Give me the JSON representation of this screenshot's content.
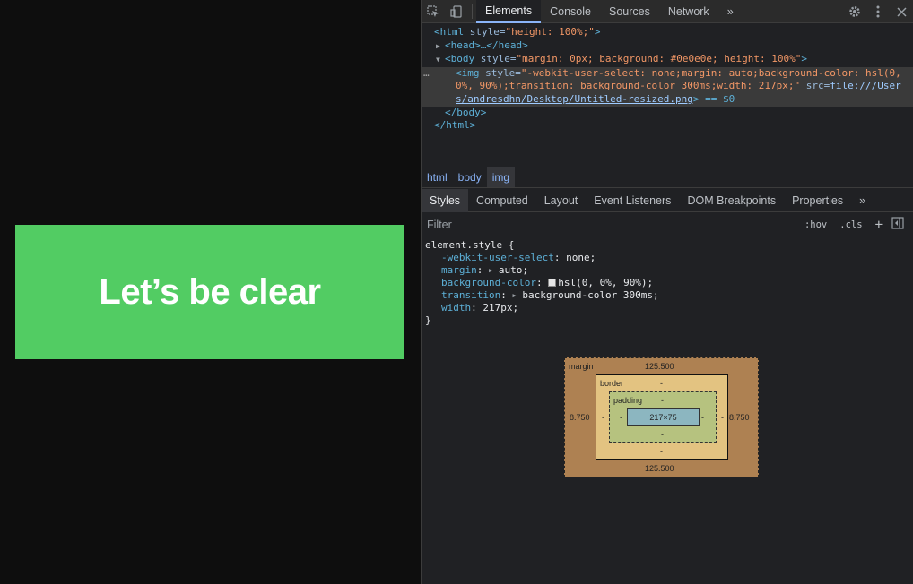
{
  "viewport": {
    "image_text": "Let’s be clear",
    "image_color": "#52cc63"
  },
  "devtools": {
    "tabs": [
      "Elements",
      "Console",
      "Sources",
      "Network"
    ],
    "more_tabs": "»",
    "dom": {
      "html_open_tag": "<html",
      "html_attr": "style",
      "html_attr_val": "\"height: 100%;\"",
      "html_close_bracket": ">",
      "head": "<head>…</head>",
      "body_open_tag": "<body",
      "body_attr": "style",
      "body_attr_val": "\"margin: 0px; background: #0e0e0e; height: 100%\"",
      "body_close_bracket": ">",
      "ellipsis": "…",
      "img_open_tag": "<img",
      "img_attr": "style",
      "img_style_1": "\"-webkit-user-select: none;margin: auto;background-color: hsl(0,",
      "img_style_2": "0%, 90%);transition: background-color 300ms;width: 217px;\"",
      "img_src_attr": "src",
      "img_src_1": "file:///User",
      "img_src_2": "s/andresdhn/Desktop/Untitled-resized.png",
      "img_close": "> == $0",
      "body_close": "</body>",
      "html_close": "</html>"
    },
    "breadcrumb": [
      "html",
      "body",
      "img"
    ],
    "subtabs": [
      "Styles",
      "Computed",
      "Layout",
      "Event Listeners",
      "DOM Breakpoints",
      "Properties"
    ],
    "subtabs_more": "»",
    "filter": {
      "placeholder": "Filter",
      "hov": ":hov",
      "cls": ".cls",
      "add": "+"
    },
    "styles": {
      "selector": "element.style {",
      "props": [
        {
          "name": "-webkit-user-select",
          "value": "none;"
        },
        {
          "name": "margin",
          "value": "auto;"
        },
        {
          "name": "background-color",
          "value": "hsl(0, 0%, 90%);"
        },
        {
          "name": "transition",
          "value": "background-color 300ms;"
        },
        {
          "name": "width",
          "value": "217px;"
        }
      ],
      "close": "}"
    },
    "box_model": {
      "margin_label": "margin",
      "margin_top": "125.500",
      "margin_bottom": "125.500",
      "margin_left": "8.750",
      "margin_right": "8.750",
      "border_label": "border",
      "border_top": "-",
      "border_bottom": "-",
      "border_left": "-",
      "border_right": "-",
      "padding_label": "padding",
      "padding_top": "-",
      "padding_bottom": "-",
      "padding_left": "-",
      "padding_right": "-",
      "content": "217×75"
    }
  }
}
